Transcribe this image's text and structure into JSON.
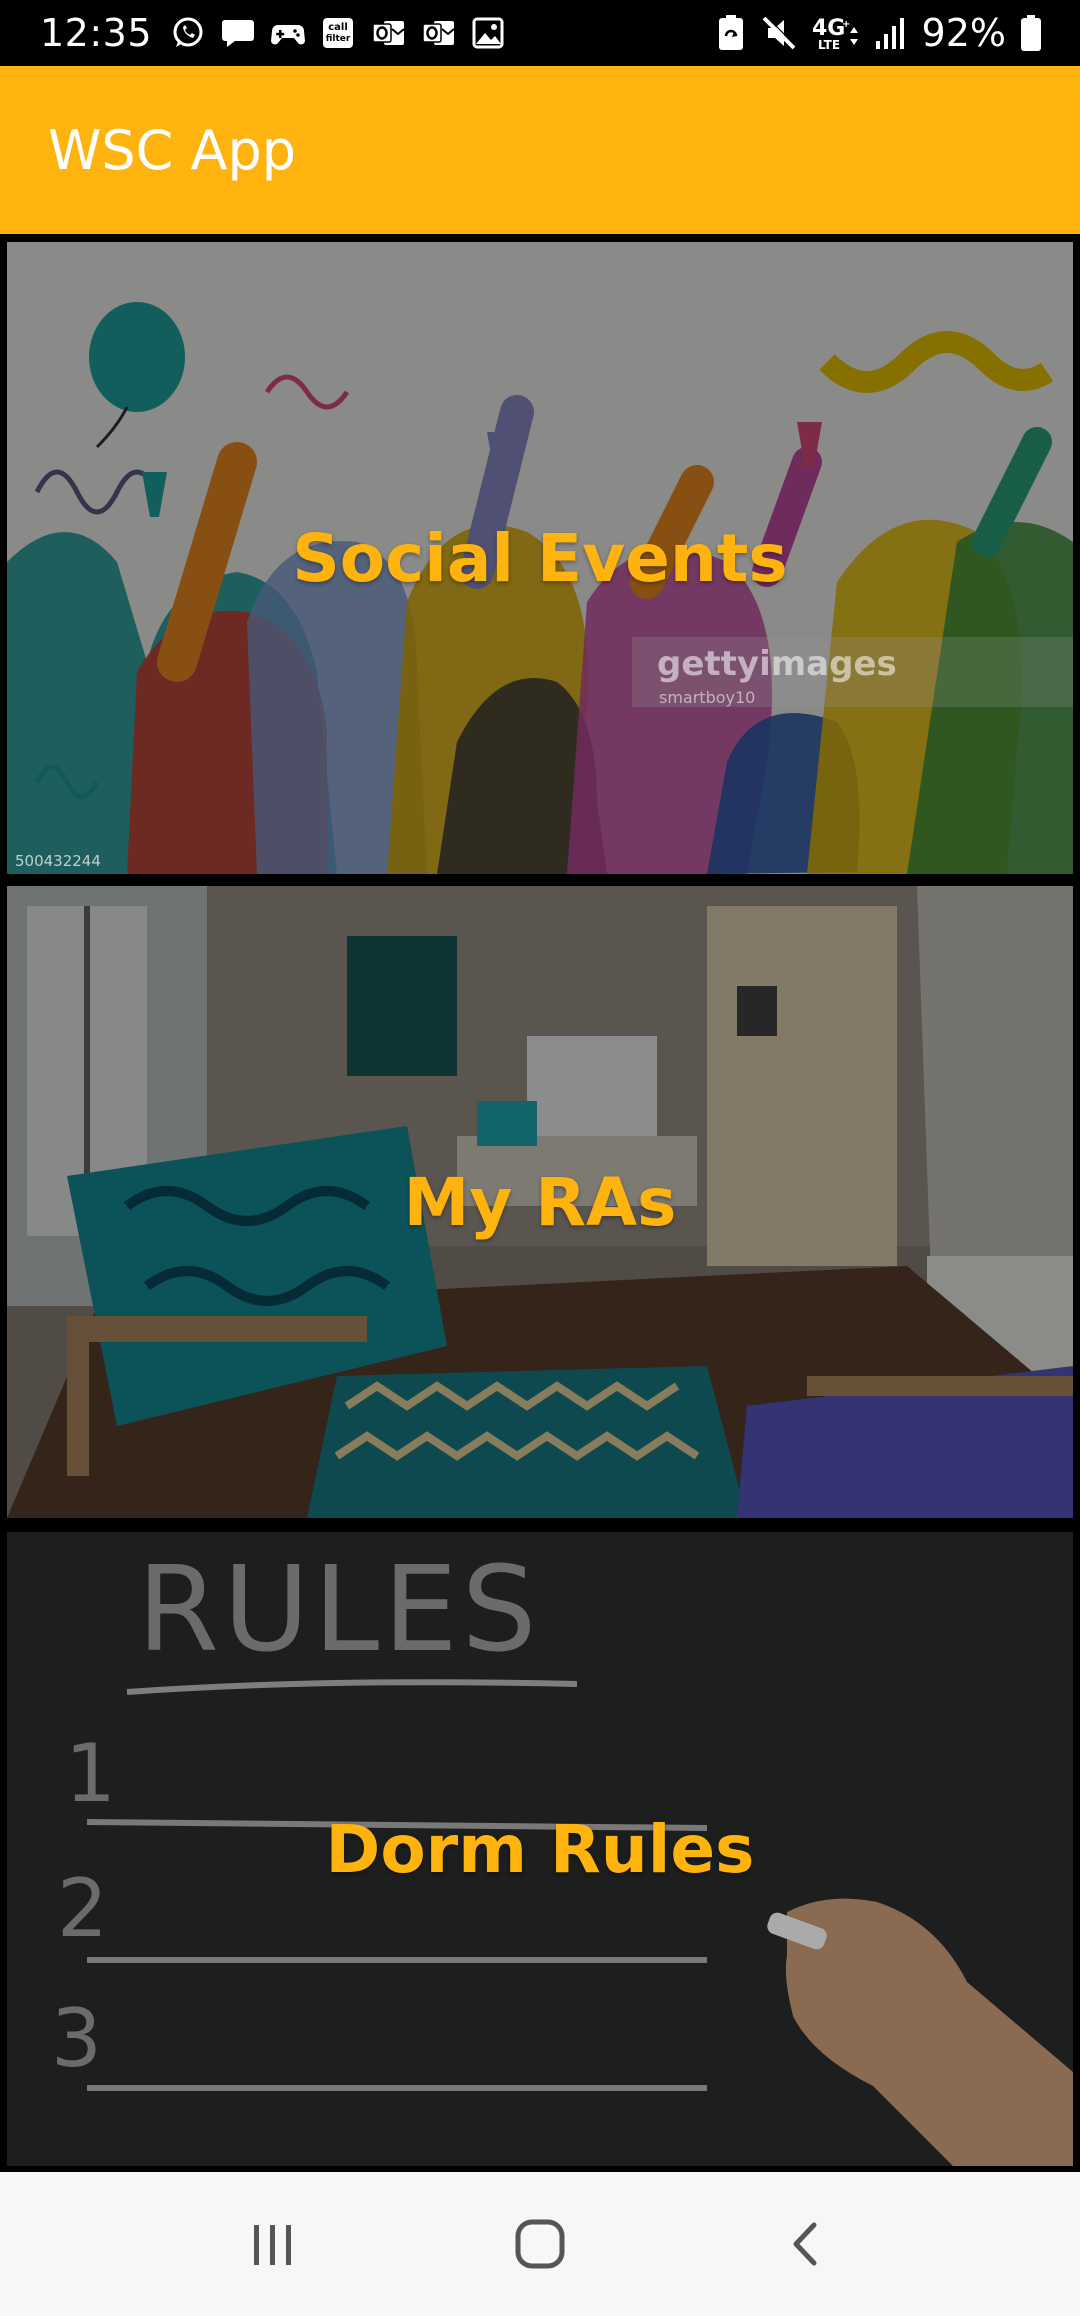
{
  "status_bar": {
    "time": "12:35",
    "battery_percent": "92%",
    "notification_icons": [
      "whatsapp-icon",
      "message-icon",
      "game-controller-icon",
      "call-filter-icon",
      "outlook-icon",
      "outlook-icon-2",
      "gallery-icon"
    ],
    "status_icons": [
      "battery-saver-icon",
      "mute-icon",
      "lte-signal-icon",
      "signal-bars-icon",
      "battery-icon"
    ]
  },
  "app_bar": {
    "title": "WSC App",
    "color": "#FFB30F"
  },
  "cards": {
    "social": {
      "label": "Social Events",
      "watermark": "gettyimages",
      "credit": "smartboy10",
      "image_id": "500432244"
    },
    "ras": {
      "label": "My RAs"
    },
    "rules": {
      "label": "Dorm Rules",
      "board_heading": "RULES",
      "numbers": [
        "1",
        "2",
        "3"
      ]
    }
  },
  "nav_bar": {
    "icons": [
      "recent-apps-icon",
      "home-icon",
      "back-icon"
    ]
  }
}
